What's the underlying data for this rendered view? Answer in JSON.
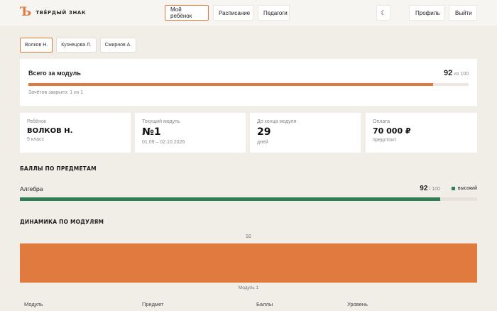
{
  "brand": {
    "logo_glyph": "Ъ",
    "name": "ТВЁРДЫЙ ЗНАК",
    "accent": "#e07a3f"
  },
  "nav": {
    "my_child": "Мой ребёнок",
    "schedule": "Расписание",
    "teachers": "Педагоги"
  },
  "header_actions": {
    "theme_icon": "☾",
    "profile": "Профиль",
    "logout": "Выйти"
  },
  "children": [
    "Волков Н.",
    "Кузнецова Л.",
    "Смирнов А."
  ],
  "total": {
    "title": "Всего за модуль",
    "score": "92",
    "score_of": "из 100",
    "progress": 0.92,
    "subtitle": "Зачётов закрыто: 1 из 1"
  },
  "stats": [
    {
      "label": "Ребёнок",
      "value": "ВОЛКОВ Н.",
      "sub": "9 класс"
    },
    {
      "label": "Текущий модуль",
      "value": "№1",
      "sub": "01.09 – 02.10.2026"
    },
    {
      "label": "До конца модуля",
      "value": "29",
      "sub": "дней"
    },
    {
      "label": "Оплата",
      "value": "70 000 ₽",
      "sub": "предстоит"
    }
  ],
  "subjects_section": {
    "title": "БАЛЛЫ ПО ПРЕДМЕТАМ",
    "items": [
      {
        "name": "Алгебра",
        "score": "92",
        "score_of": "/ 100",
        "level": "высокий",
        "progress": 0.92,
        "color": "#2f7d54"
      }
    ]
  },
  "dynamics_section": {
    "title": "ДИНАМИКА ПО МОДУЛЯМ"
  },
  "chart_data": {
    "type": "bar",
    "categories": [
      "Модуль 1"
    ],
    "values": [
      92
    ],
    "ylim": [
      0,
      100
    ],
    "bar_color": "#e07a3f",
    "grid": false
  },
  "table": {
    "headers": [
      "Модуль",
      "Предмет",
      "Баллы",
      "Уровень"
    ]
  }
}
